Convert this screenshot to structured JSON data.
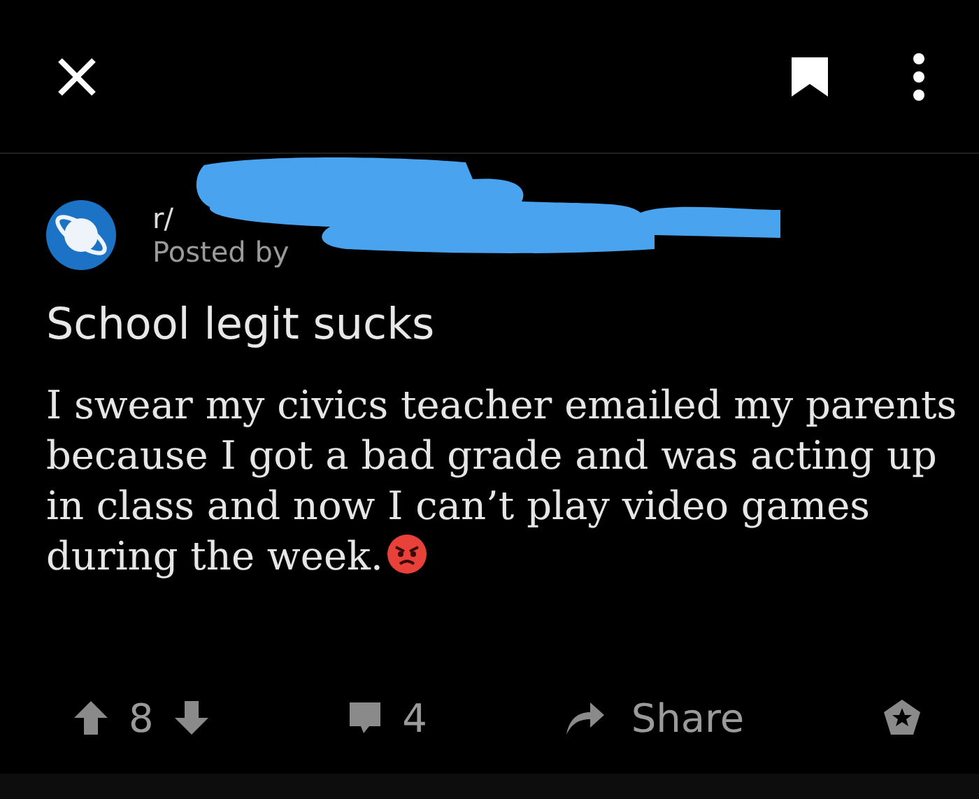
{
  "post": {
    "subreddit_prefix": "r/",
    "posted_by_label": "Posted by",
    "title": "School legit sucks",
    "body": "I swear my civics teacher emailed my parents because I got a bad grade and was acting up in class and now I can’t play video games during the week."
  },
  "actions": {
    "score": "8",
    "comments": "4",
    "share": "Share"
  }
}
